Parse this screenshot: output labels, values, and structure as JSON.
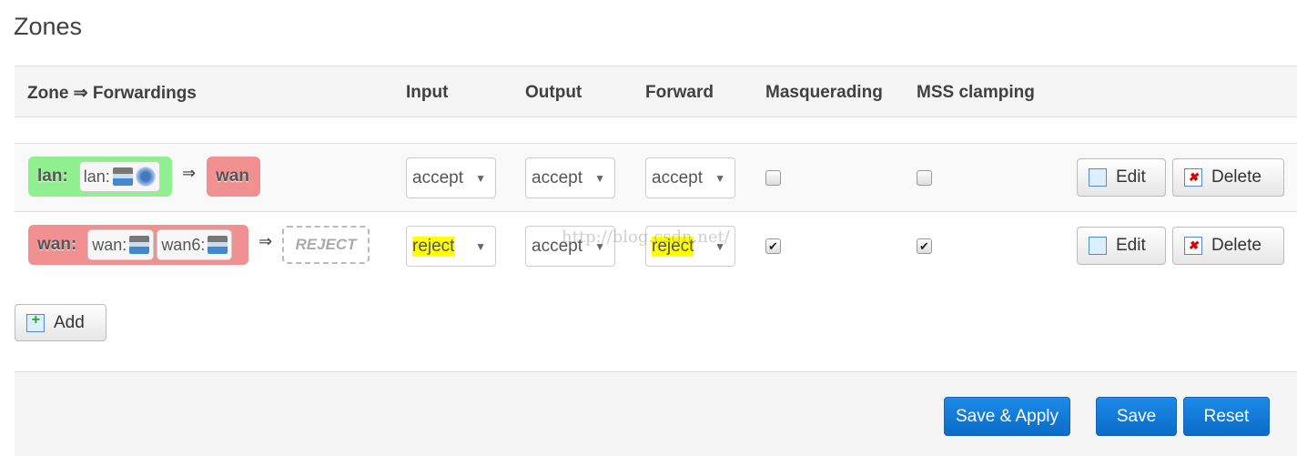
{
  "title": "Zones",
  "headers": [
    "Zone ⇒ Forwardings",
    "Input",
    "Output",
    "Forward",
    "Masquerading",
    "MSS clamping"
  ],
  "arrow": "⇒",
  "rows": [
    {
      "zone": "lan:",
      "zone_color": "#90f090",
      "interfaces": [
        {
          "label": "lan:",
          "icons": [
            "ethernet-icon",
            "wifi-icon"
          ]
        }
      ],
      "forward_to": "wan",
      "input": "accept",
      "output": "accept",
      "forward": "accept",
      "masquerading": false,
      "mss_clamping": false
    },
    {
      "zone": "wan:",
      "zone_color": "#f09090",
      "interfaces": [
        {
          "label": "wan:",
          "icons": [
            "ethernet-icon"
          ]
        },
        {
          "label": "wan6:",
          "icons": [
            "ethernet-icon"
          ]
        }
      ],
      "forward_to": "REJECT",
      "input": "reject",
      "output": "accept",
      "forward": "reject",
      "masquerading": true,
      "mss_clamping": true
    }
  ],
  "edit_label": "Edit",
  "delete_label": "Delete",
  "add_label": "Add",
  "footer": {
    "save_apply": "Save & Apply",
    "save": "Save",
    "reset": "Reset"
  },
  "watermark": "http://blog.csdn.net/",
  "highlight_color": "#ffff00"
}
